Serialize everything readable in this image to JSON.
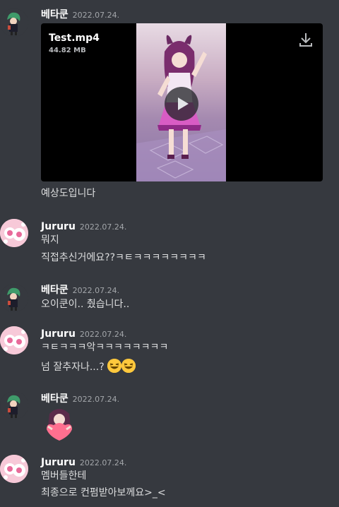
{
  "messages": [
    {
      "user": "베타쿤",
      "timestamp": "2022.07.24.",
      "attachment": {
        "filename": "Test.mp4",
        "size": "44.82 MB",
        "icon": "download-icon",
        "play_icon": "play-icon"
      },
      "lines": [
        "예상도입니다"
      ]
    },
    {
      "user": "Jururu",
      "timestamp": "2022.07.24.",
      "lines": [
        "뭐지",
        "직접추신거에요??ㅋㅌㅋㅋㅋㅋㅋㅋㅋㅋ"
      ]
    },
    {
      "user": "베타쿤",
      "timestamp": "2022.07.24.",
      "lines": [
        "오이쿤이.. 췄습니다.."
      ]
    },
    {
      "user": "Jururu",
      "timestamp": "2022.07.24.",
      "lines": [
        "ㅋㅌㅋㅋㅋ악ㅋㅋㅋㅋㅋㅋㅋㅋ",
        "넘 잘추자나...?"
      ],
      "emoji": [
        "grinning-squinting-face",
        "grinning-squinting-face"
      ]
    },
    {
      "user": "베타쿤",
      "timestamp": "2022.07.24.",
      "sticker": "heart-sticker"
    },
    {
      "user": "Jururu",
      "timestamp": "2022.07.24.",
      "lines": [
        "멤버들한테",
        "최종으로 컨펌받아보께요>_<"
      ]
    }
  ],
  "colors": {
    "background": "#36393f",
    "username": "#ffffff",
    "timestamp": "#a3a6aa",
    "text": "#dcddde"
  }
}
